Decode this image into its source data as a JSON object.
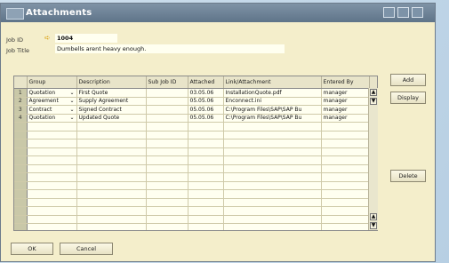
{
  "window": {
    "title": "Attachments"
  },
  "header": {
    "job_id_label": "Job ID",
    "job_id_value": "1004",
    "job_title_label": "Job Title",
    "job_title_value": "Dumbells arent heavy enough."
  },
  "table": {
    "columns": [
      "Group",
      "Description",
      "Sub Job ID",
      "Attached",
      "Link/Attachment",
      "Entered By"
    ],
    "rows": [
      {
        "n": "1",
        "group": "Quotation",
        "desc": "First Quote",
        "sub": "",
        "attached": "03.05.06",
        "link": "InstallationQuote.pdf",
        "by": "manager"
      },
      {
        "n": "2",
        "group": "Agreement",
        "desc": "Supply Agreement",
        "sub": "",
        "attached": "05.05.06",
        "link": "Enconnect.ini",
        "by": "manager"
      },
      {
        "n": "3",
        "group": "Contract",
        "desc": "Signed Contract",
        "sub": "",
        "attached": "05.05.06",
        "link": "C:\\Program Files\\SAP\\SAP Bu",
        "by": "manager"
      },
      {
        "n": "4",
        "group": "Quotation",
        "desc": "Updated Quote",
        "sub": "",
        "attached": "05.05.06",
        "link": "C:\\Program Files\\SAP\\SAP Bu",
        "by": "manager"
      }
    ]
  },
  "buttons": {
    "add": "Add",
    "display": "Display",
    "delete": "Delete",
    "ok": "OK",
    "cancel": "Cancel"
  },
  "icons": {
    "arrow": "➪",
    "up": "▲",
    "down": "▼",
    "dropdown": "⌄"
  }
}
